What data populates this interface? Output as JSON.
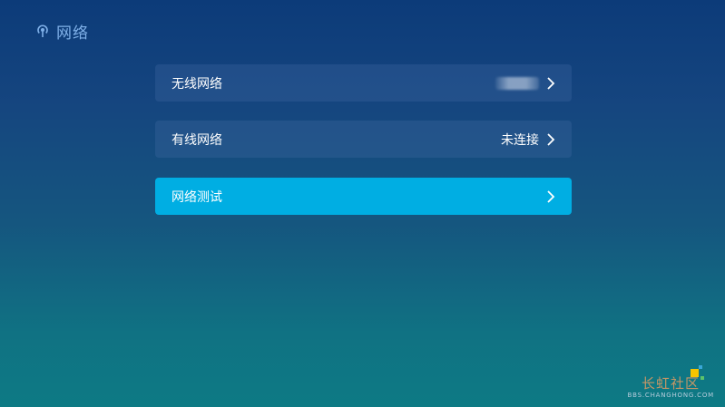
{
  "header": {
    "title": "网络",
    "icon": "network-icon"
  },
  "menu": {
    "items": [
      {
        "label": "无线网络",
        "value": "",
        "value_redacted": true,
        "icon": "chevron-right-icon"
      },
      {
        "label": "有线网络",
        "value": "未连接",
        "icon": "chevron-right-icon"
      },
      {
        "label": "网络测试",
        "value": "",
        "selected": true,
        "icon": "chevron-right-icon"
      }
    ]
  },
  "watermark": {
    "brand": "长虹社区",
    "url": "BBS.CHANGHONG.COM"
  },
  "colors": {
    "background_top": "#0c3b79",
    "background_bottom": "#0d7a84",
    "selected_item": "#00aee3",
    "title_accent": "#7fb0e8"
  }
}
